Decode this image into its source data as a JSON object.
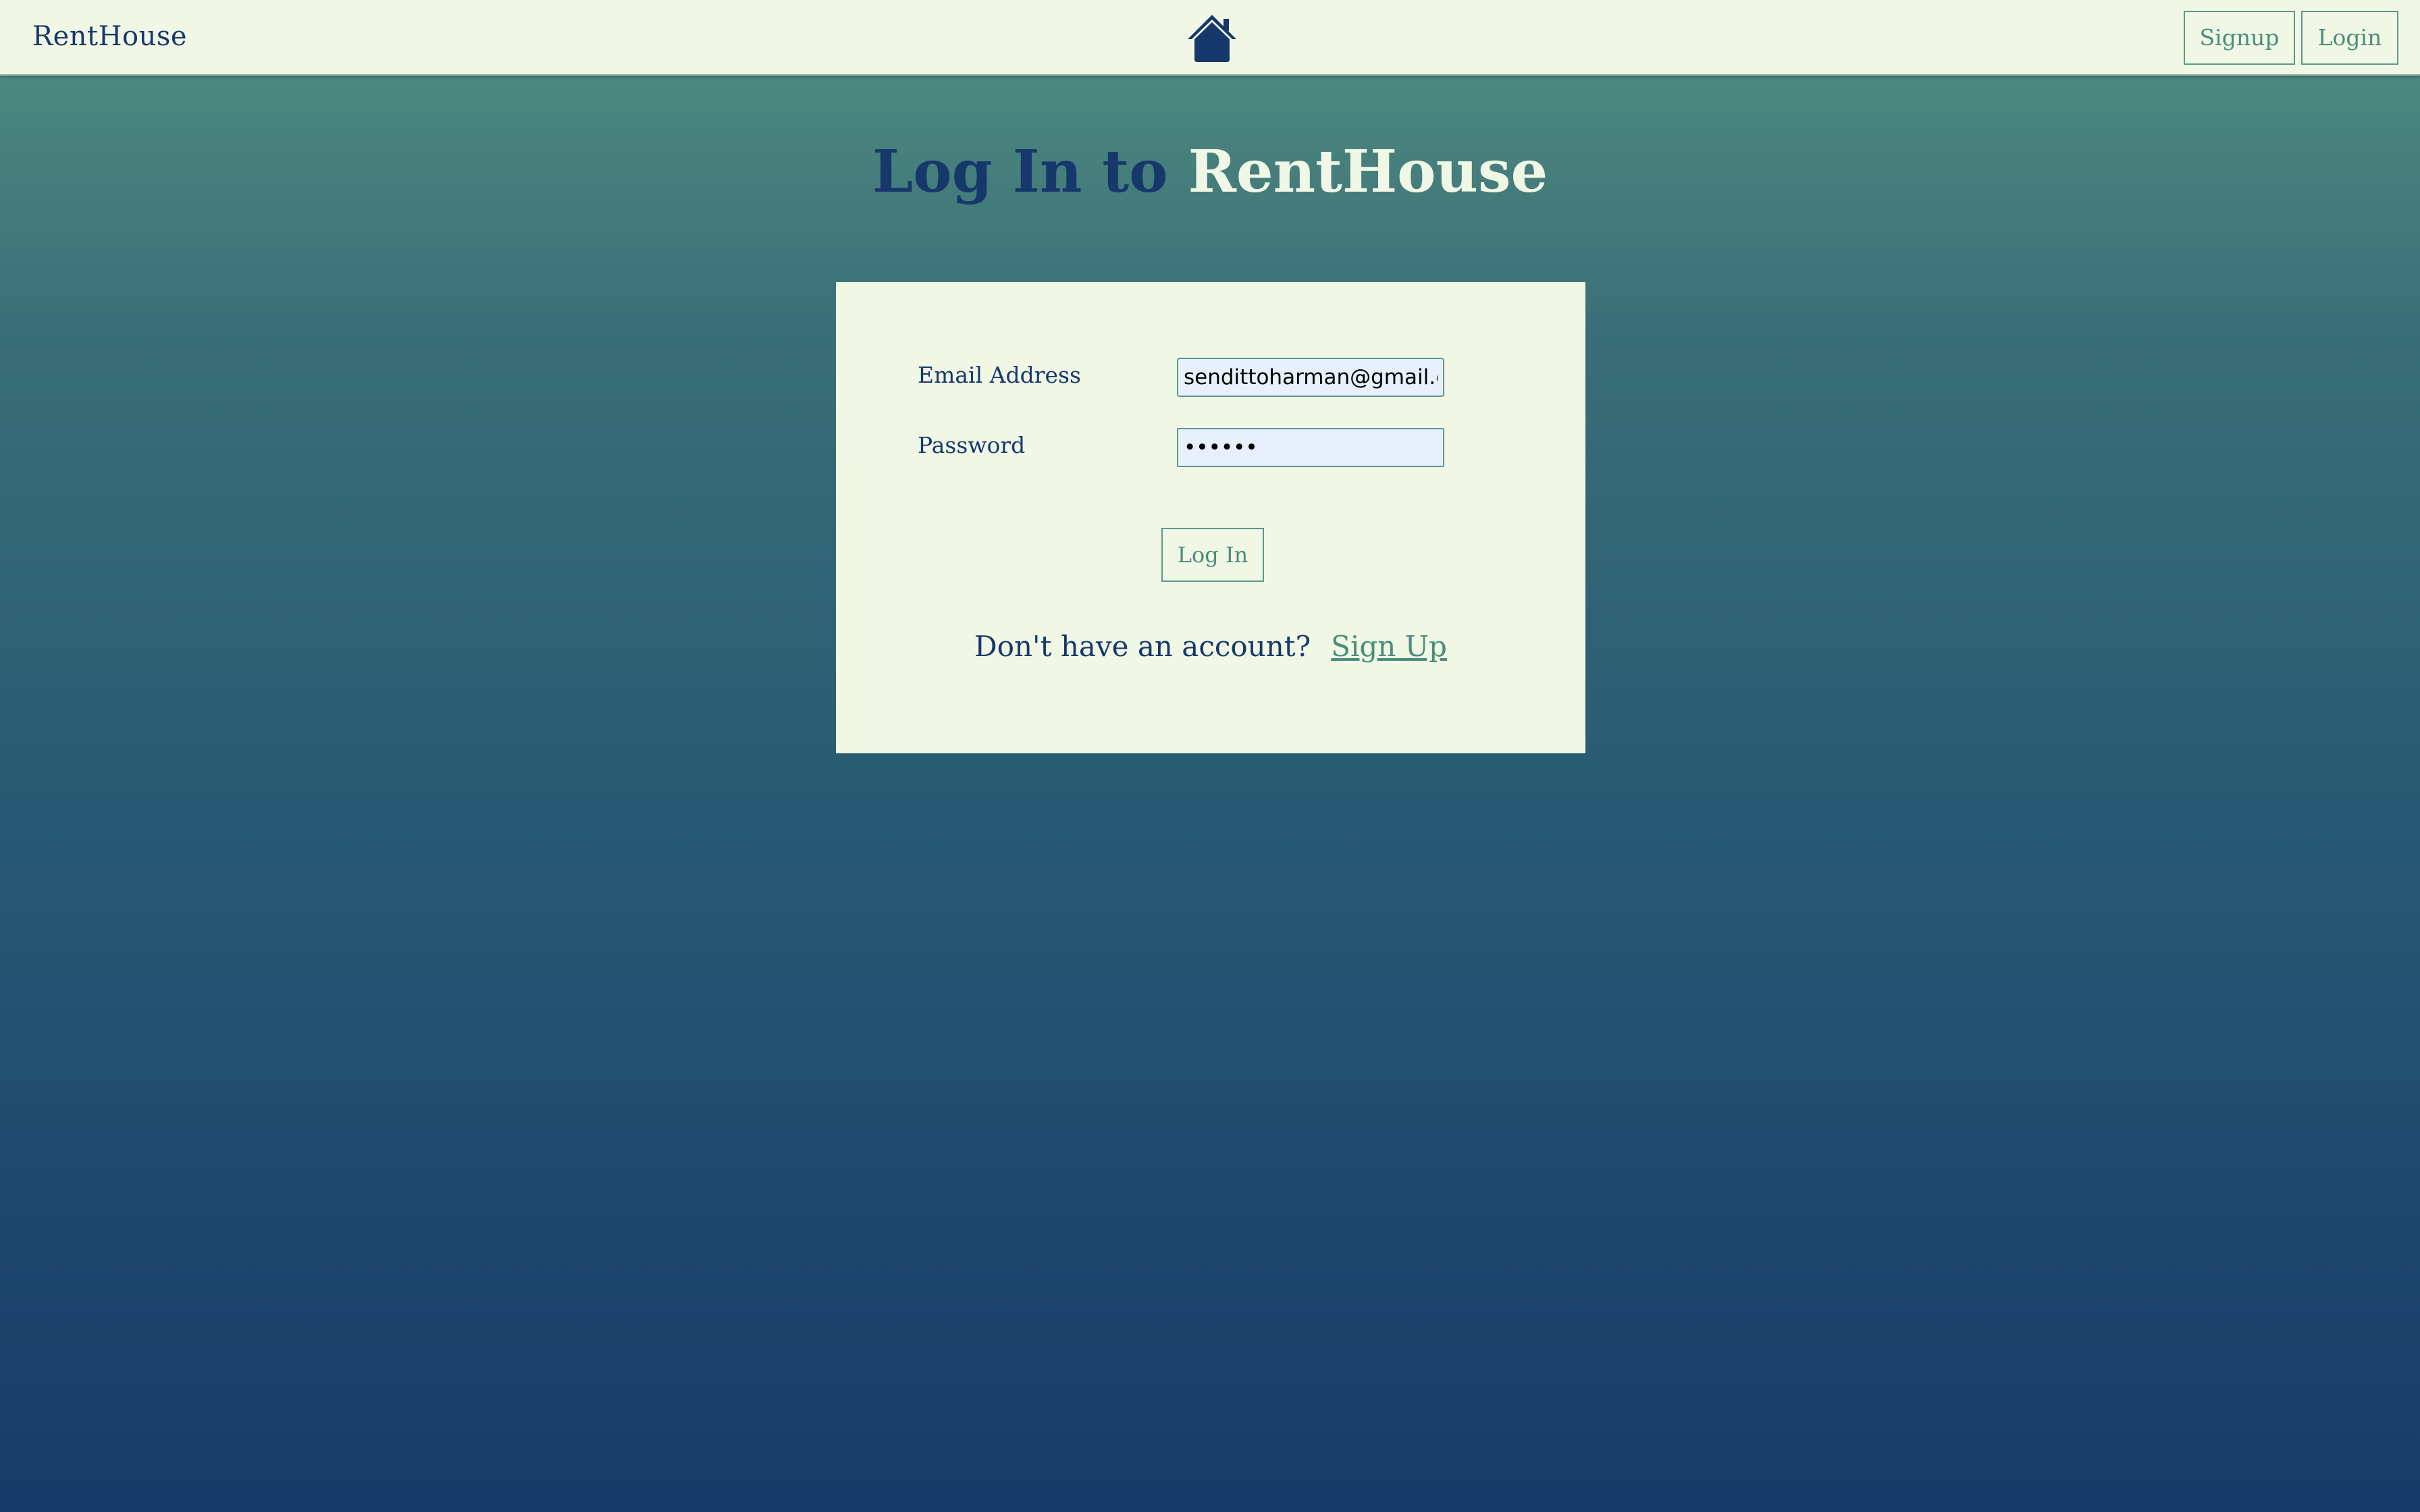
{
  "navbar": {
    "brand": "RentHouse",
    "home_icon": "house-icon",
    "signup_label": "Signup",
    "login_label": "Login"
  },
  "page": {
    "title_prefix": "Log In to",
    "title_brand": "RentHouse"
  },
  "form": {
    "email_label": "Email Address",
    "email_value": "sendittoharman@gmail.com",
    "password_label": "Password",
    "password_value": "••••••",
    "submit_label": "Log In",
    "signup_prompt": "Don't have an account?",
    "signup_link": "Sign Up"
  },
  "colors": {
    "navy": "#17386b",
    "teal": "#4a8d7c",
    "cream": "#f0f7e5",
    "input_bg": "#e8f0fe"
  }
}
